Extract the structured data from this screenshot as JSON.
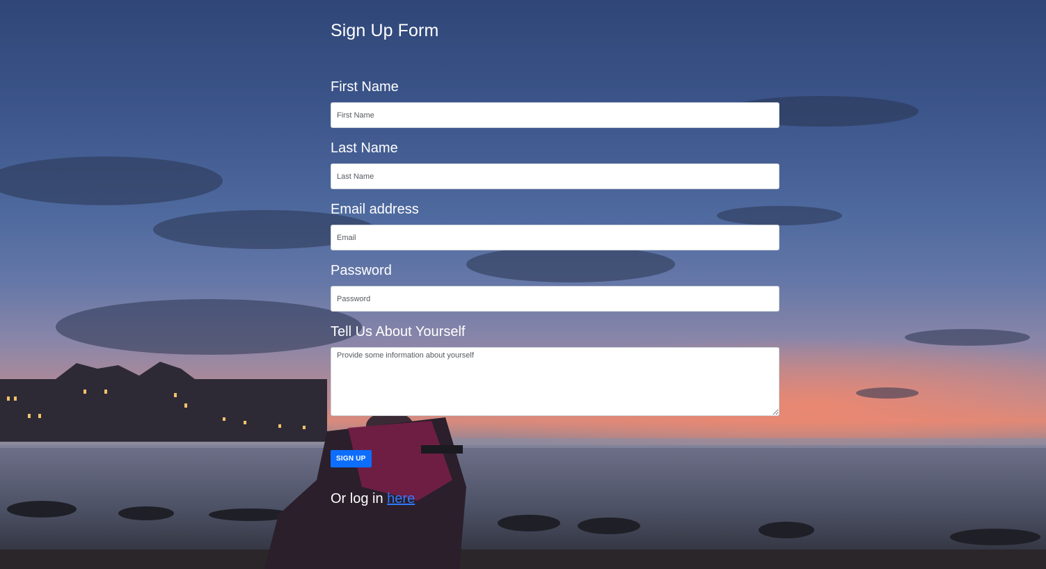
{
  "form": {
    "title": "Sign Up Form",
    "fields": [
      {
        "label": "First Name",
        "placeholder": "First Name",
        "value": ""
      },
      {
        "label": "Last Name",
        "placeholder": "Last Name",
        "value": ""
      },
      {
        "label": "Email address",
        "placeholder": "Email",
        "value": ""
      },
      {
        "label": "Password",
        "placeholder": "Password",
        "value": ""
      }
    ],
    "about": {
      "label": "Tell Us About Yourself",
      "placeholder": "Provide some information about yourself",
      "value": ""
    },
    "submit_label": "SIGN UP",
    "login_prefix": "Or log in",
    "login_link": "here"
  },
  "colors": {
    "accent": "#0d6efd",
    "link": "#2f7bff",
    "text": "#ffffff"
  }
}
